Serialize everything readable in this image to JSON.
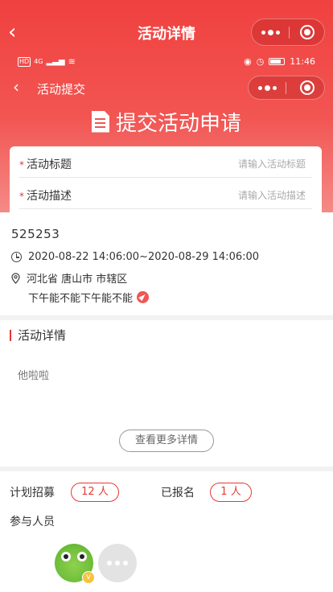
{
  "header": {
    "title": "活动详情",
    "inner_title": "活动提交",
    "submit_heading": "提交活动申请"
  },
  "status_bar": {
    "signal_label": "HD",
    "network": "4G",
    "time": "11:46"
  },
  "form": {
    "fields": [
      {
        "label": "活动标题",
        "placeholder": "请输入活动标题"
      },
      {
        "label": "活动描述",
        "placeholder": "请输入活动描述"
      }
    ]
  },
  "activity": {
    "id": "525253",
    "datetime": "2020-08-22 14:06:00~2020-08-29 14:06:00",
    "location": "河北省 唐山市 市辖区",
    "address": "下午能不能下午能不能"
  },
  "detail": {
    "section_title": "活动详情",
    "body": "他啦啦",
    "more_button": "查看更多详情"
  },
  "enrollment": {
    "planned_label": "计划招募",
    "planned_value": "12 人",
    "enrolled_label": "已报名",
    "enrolled_value": "1 人",
    "participants_label": "参与人员",
    "avatar_badge": "V"
  },
  "colors": {
    "accent": "#e53935",
    "header_top": "#f0413f"
  }
}
